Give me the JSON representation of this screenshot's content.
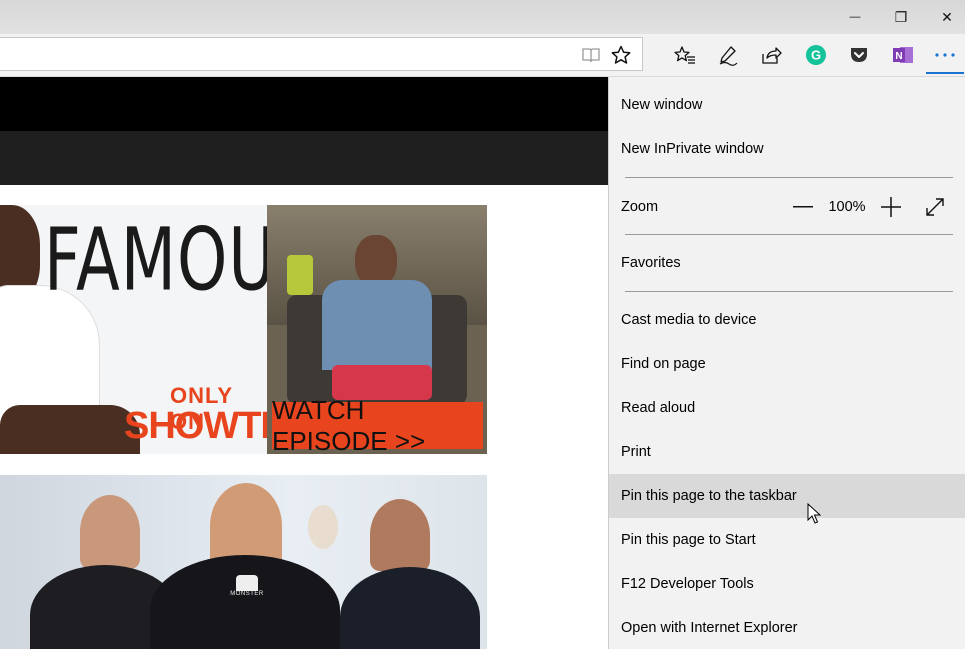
{
  "window": {
    "minimize_glyph": "—",
    "restore_glyph": "❐",
    "close_glyph": "✕"
  },
  "toolbar": {
    "icons": [
      "reading-view-icon",
      "favorite-star-icon",
      "favorites-hub-icon",
      "web-note-icon",
      "share-icon",
      "grammarly-icon",
      "pocket-icon",
      "onenote-icon",
      "more-actions-icon"
    ],
    "grammarly_color": "#15c39a",
    "pocket_color": "#333333",
    "onenote_color": "#7f3cb5",
    "accent": "#1a73d0"
  },
  "ad": {
    "headline": "FAMOUS",
    "only_on": "ONLY ON",
    "network": "SHOWTIME",
    "cta": "WATCH EPISODE >>",
    "accent": "#e8451e"
  },
  "photo": {
    "shirt_text": "MONSTER"
  },
  "menu": {
    "new_window": "New window",
    "new_inprivate": "New InPrivate window",
    "zoom_label": "Zoom",
    "zoom_value": "100%",
    "favorites": "Favorites",
    "cast": "Cast media to device",
    "find": "Find on page",
    "read_aloud": "Read aloud",
    "print": "Print",
    "pin_taskbar": "Pin this page to the taskbar",
    "pin_start": "Pin this page to Start",
    "dev_tools": "F12 Developer Tools",
    "open_ie": "Open with Internet Explorer"
  }
}
